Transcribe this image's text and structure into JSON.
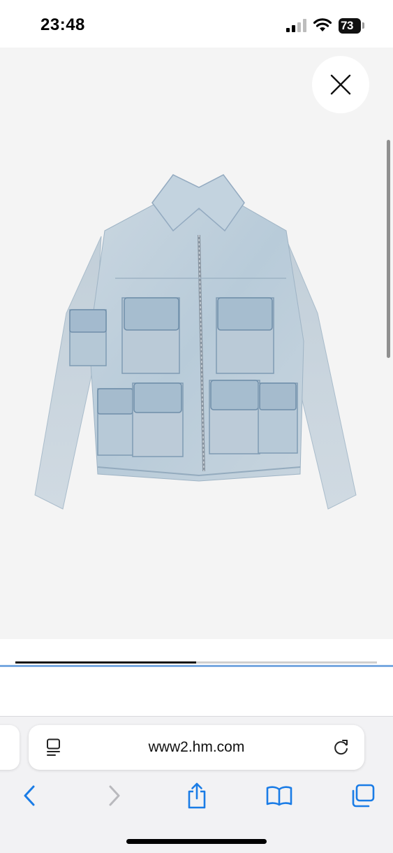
{
  "status_bar": {
    "time": "23:48",
    "battery_level": "73",
    "icons": [
      "signal-icon",
      "wifi-icon",
      "battery-icon"
    ]
  },
  "gallery": {
    "image_description_icon": "denim-jacket-image",
    "close_icon": "close-icon",
    "image_index_fraction": 0.5
  },
  "browser": {
    "url": "www2.hm.com",
    "address_bar_icons": [
      "reader-icon",
      "reload-icon"
    ],
    "toolbar_icons": [
      "back-icon",
      "forward-icon",
      "share-icon",
      "bookmarks-icon",
      "tabs-icon"
    ],
    "accent_color": "#1a7ce6",
    "disabled_color": "#b9b9bd"
  }
}
